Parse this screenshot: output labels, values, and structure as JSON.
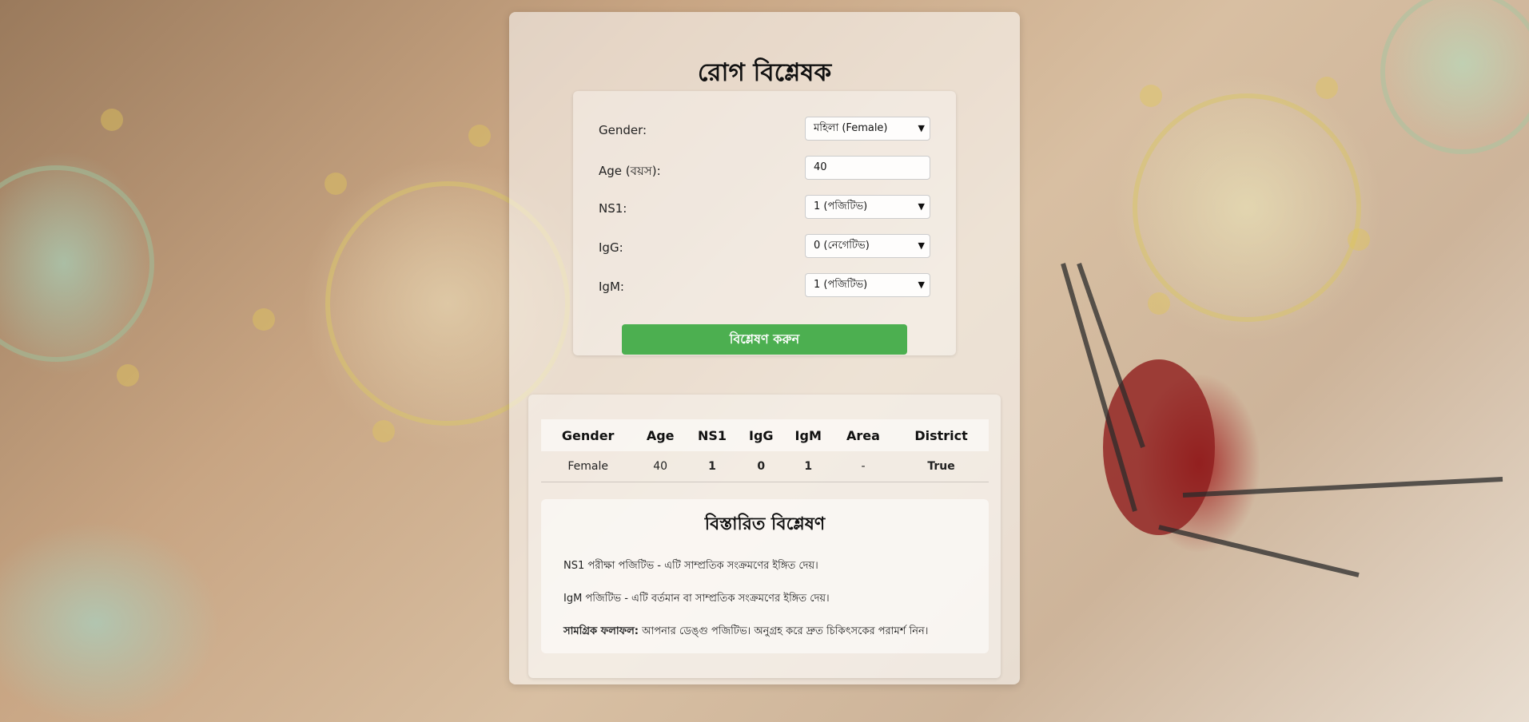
{
  "page": {
    "title": "রোগ বিশ্লেষক"
  },
  "form": {
    "gender": {
      "label": "Gender:",
      "value": "মহিলা (Female)"
    },
    "age": {
      "label": "Age (বয়স):",
      "value": "40"
    },
    "ns1": {
      "label": "NS1:",
      "value": "1 (পজিটিভ)"
    },
    "igg": {
      "label": "IgG:",
      "value": "0 (নেগেটিভ)"
    },
    "igm": {
      "label": "IgM:",
      "value": "1 (পজিটিভ)"
    },
    "submit_label": "বিশ্লেষণ করুন"
  },
  "results": {
    "headers": [
      "Gender",
      "Age",
      "NS1",
      "IgG",
      "IgM",
      "Area",
      "District"
    ],
    "row": {
      "gender": "Female",
      "age": "40",
      "ns1": "1",
      "igg": "0",
      "igm": "1",
      "area": "-",
      "district": "True"
    }
  },
  "detail": {
    "title": "বিস্তারিত বিশ্লেষণ",
    "line1": "NS1 পরীক্ষা পজিটিভ - এটি সাম্প্রতিক সংক্রমণের ইঙ্গিত দেয়।",
    "line2": "IgM পজিটিভ - এটি বর্তমান বা সাম্প্রতিক সংক্রমণের ইঙ্গিত দেয়।",
    "summary_label": "সামগ্রিক ফলাফল:",
    "summary_text": " আপনার ডেঙ্গু পজিটিভ। অনুগ্রহ করে দ্রুত চিকিৎসকের পরামর্শ নিন।"
  },
  "colors": {
    "button": "#4caf50",
    "positive": "#e53935",
    "negative": "#43a047"
  }
}
